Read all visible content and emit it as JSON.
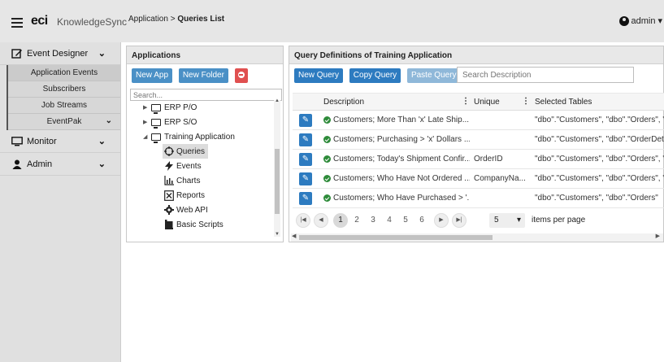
{
  "header": {
    "brand": "eci",
    "brand_sub": "KnowledgeSync",
    "breadcrumb_prefix": "Application > ",
    "breadcrumb_current": "Queries List",
    "user": "admin"
  },
  "leftnav": {
    "event_designer": "Event Designer",
    "sub_items": [
      "Application Events",
      "Subscribers",
      "Job Streams",
      "EventPak"
    ],
    "monitor": "Monitor",
    "admin": "Admin"
  },
  "apps": {
    "title": "Applications",
    "new_app": "New App",
    "new_folder": "New Folder",
    "search_placeholder": "Search...",
    "tree": {
      "erp_po": "ERP P/O",
      "erp_so": "ERP S/O",
      "training": "Training Application",
      "queries": "Queries",
      "events": "Events",
      "charts": "Charts",
      "reports": "Reports",
      "webapi": "Web API",
      "scripts": "Basic Scripts"
    }
  },
  "queries": {
    "title": "Query Definitions of Training Application",
    "new_query": "New Query",
    "copy_query": "Copy Query",
    "paste_query": "Paste Query",
    "search_placeholder": "Search Description",
    "columns": [
      "Description",
      "Unique",
      "Selected Tables"
    ],
    "rows": [
      {
        "desc": "Customers; More Than 'x' Late Ship...",
        "unique": "",
        "tables": "\"dbo\".\"Customers\", \"dbo\".\"Orders\", \"c"
      },
      {
        "desc": "Customers; Purchasing > 'x' Dollars ...",
        "unique": "",
        "tables": "\"dbo\".\"Customers\", \"dbo\".\"OrderDeta"
      },
      {
        "desc": "Customers; Today's Shipment Confir...",
        "unique": "OrderID",
        "tables": "\"dbo\".\"Customers\", \"dbo\".\"Orders\", \"c"
      },
      {
        "desc": "Customers; Who Have Not Ordered ...",
        "unique": "CompanyNa...",
        "tables": "\"dbo\".\"Customers\", \"dbo\".\"Orders\", \"c"
      },
      {
        "desc": "Customers; Who Have Purchased > '...",
        "unique": "",
        "tables": "\"dbo\".\"Customers\", \"dbo\".\"Orders\""
      }
    ],
    "pages": [
      "1",
      "2",
      "3",
      "4",
      "5",
      "6"
    ],
    "page_size": "5",
    "items_per_page": "items per page"
  }
}
